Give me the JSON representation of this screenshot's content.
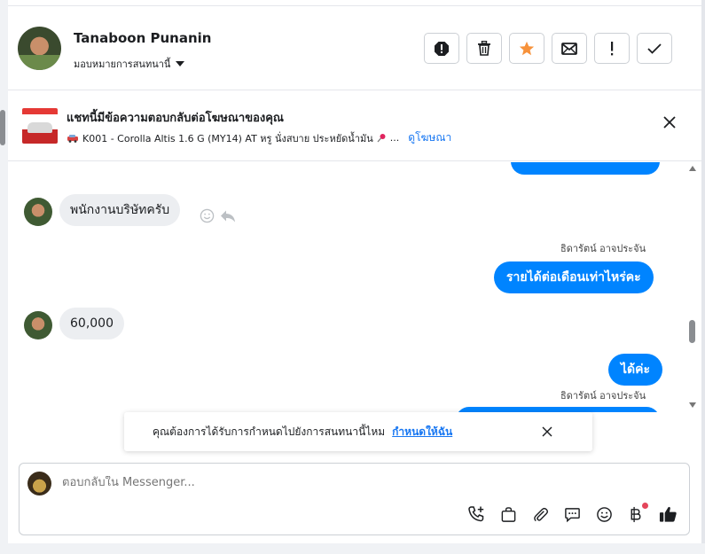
{
  "header": {
    "contact_name": "Tanaboon Punanin",
    "assign_label": "มอบหมายการสนทนานี้"
  },
  "ad": {
    "title": "แชทนี้มีข้อความตอบกลับต่อโฆษณาของคุณ",
    "description": "K001 - Corolla Altis 1.6 G (MY14) AT หรู นั่งสบาย ประหยัดน้ำมัน",
    "ellipsis": "...",
    "view_ad_link": "ดูโฆษณา"
  },
  "messages": [
    {
      "direction": "in",
      "text": "พนักงานบริษัทครับ"
    },
    {
      "direction": "out",
      "sender": "ธิดารัตน์ อาจประจัน",
      "text": "รายได้ต่อเดือนเท่าไหร่คะ"
    },
    {
      "direction": "in",
      "text": "60,000"
    },
    {
      "direction": "out",
      "text": "ได้ค่ะ"
    },
    {
      "direction": "out",
      "sender": "ธิดารัตน์ อาจประจัน",
      "text": ""
    }
  ],
  "reminder": {
    "text": "คุณต้องการได้รับการกำหนดไปยังการสนทนานี้ไหม",
    "action_label": "กำหนดให้ฉัน"
  },
  "composer": {
    "placeholder": "ตอบกลับใน Messenger..."
  },
  "colors": {
    "brand_blue": "#0084ff",
    "link_blue": "#1877f2",
    "star_orange": "#f7923b",
    "incoming_bubble": "#eceef1"
  },
  "icons": {
    "header_actions": [
      "spam-alert-icon",
      "trash-icon",
      "star-icon",
      "mark-unread-icon",
      "follow-up-icon",
      "done-check-icon"
    ],
    "composer_tools": [
      "call-plus-icon",
      "shopping-bag-icon",
      "attachment-icon",
      "saved-reply-icon",
      "emoji-icon",
      "baht-payment-icon",
      "thumbs-up-icon"
    ]
  }
}
